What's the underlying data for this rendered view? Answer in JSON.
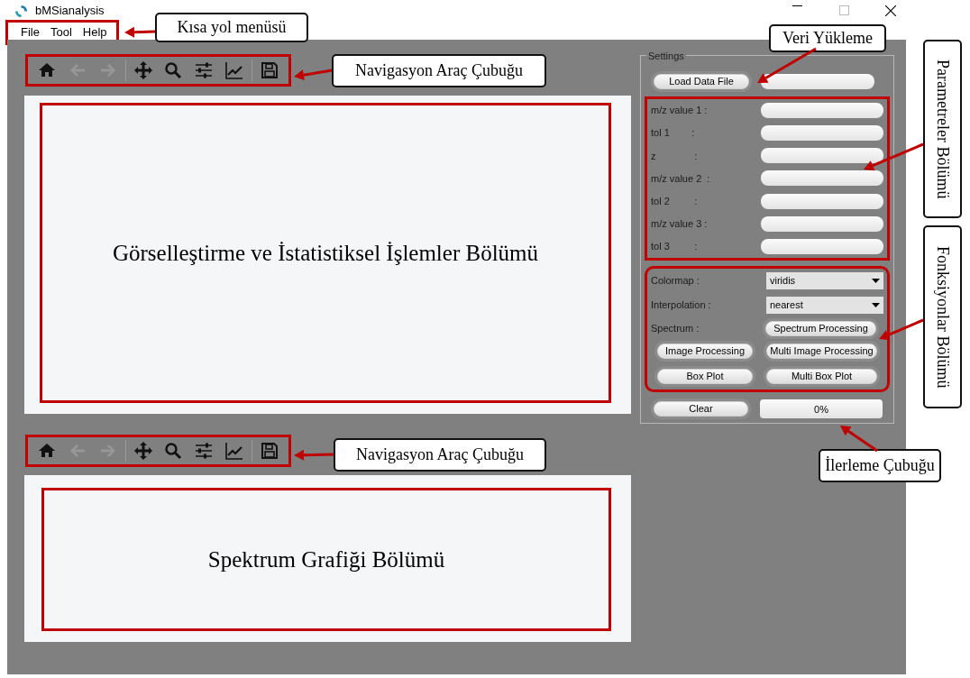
{
  "window": {
    "title": "bMSianalysis"
  },
  "menu": [
    "File",
    "Tool",
    "Help"
  ],
  "toolbars": [
    {
      "tools": [
        {
          "kind": "home",
          "disabled": false
        },
        {
          "kind": "back",
          "disabled": true
        },
        {
          "kind": "forward",
          "disabled": true
        },
        {
          "kind": "separator"
        },
        {
          "kind": "pan",
          "disabled": false
        },
        {
          "kind": "zoom",
          "disabled": false
        },
        {
          "kind": "sliders",
          "disabled": false
        },
        {
          "kind": "chart",
          "disabled": false
        },
        {
          "kind": "separator"
        },
        {
          "kind": "save",
          "disabled": false
        }
      ]
    },
    {
      "tools": [
        {
          "kind": "home",
          "disabled": false
        },
        {
          "kind": "back",
          "disabled": true
        },
        {
          "kind": "forward",
          "disabled": true
        },
        {
          "kind": "separator"
        },
        {
          "kind": "pan",
          "disabled": false
        },
        {
          "kind": "zoom",
          "disabled": false
        },
        {
          "kind": "sliders",
          "disabled": false
        },
        {
          "kind": "chart",
          "disabled": false
        },
        {
          "kind": "separator"
        },
        {
          "kind": "save",
          "disabled": false
        }
      ]
    }
  ],
  "panels": [
    {
      "label": "Görselleştirme ve İstatistiksel İşlemler Bölümü"
    },
    {
      "label": "Spektrum Grafiği Bölümü"
    }
  ],
  "settings": {
    "title": "Settings",
    "load_button": "Load Data File",
    "parameters": [
      {
        "label": "m/z value 1 :"
      },
      {
        "label": "tol 1        :"
      },
      {
        "label": "z              :"
      },
      {
        "label": "m/z value 2  :"
      },
      {
        "label": "tol 2         :"
      },
      {
        "label": "m/z value 3 :"
      },
      {
        "label": "tol 3         :"
      }
    ],
    "colormap": {
      "label": "Colormap :",
      "value": "viridis"
    },
    "interpolation": {
      "label": "Interpolation :",
      "value": "nearest"
    },
    "spectrum": {
      "label": "Spectrum :",
      "button": "Spectrum Processing"
    },
    "buttons": [
      "Image Processing",
      "Multi Image Processing",
      "Box Plot",
      "Multi Box Plot"
    ],
    "clear_button": "Clear",
    "progress": {
      "text": "0%",
      "level": 0
    }
  },
  "callouts": [
    {
      "text": "Kısa yol menüsü",
      "kind": "horizontal"
    },
    {
      "text": "Navigasyon Araç Çubuğu",
      "kind": "horizontal"
    },
    {
      "text": "Veri Yükleme",
      "kind": "horizontal"
    },
    {
      "text": "Parametreler Bölümü",
      "kind": "vertical"
    },
    {
      "text": "Fonksiyonlar Bölümü",
      "kind": "vertical"
    },
    {
      "text": "Navigasyon Araç Çubuğu",
      "kind": "horizontal"
    },
    {
      "text": "İlerleme Çubuğu",
      "kind": "horizontal"
    }
  ]
}
